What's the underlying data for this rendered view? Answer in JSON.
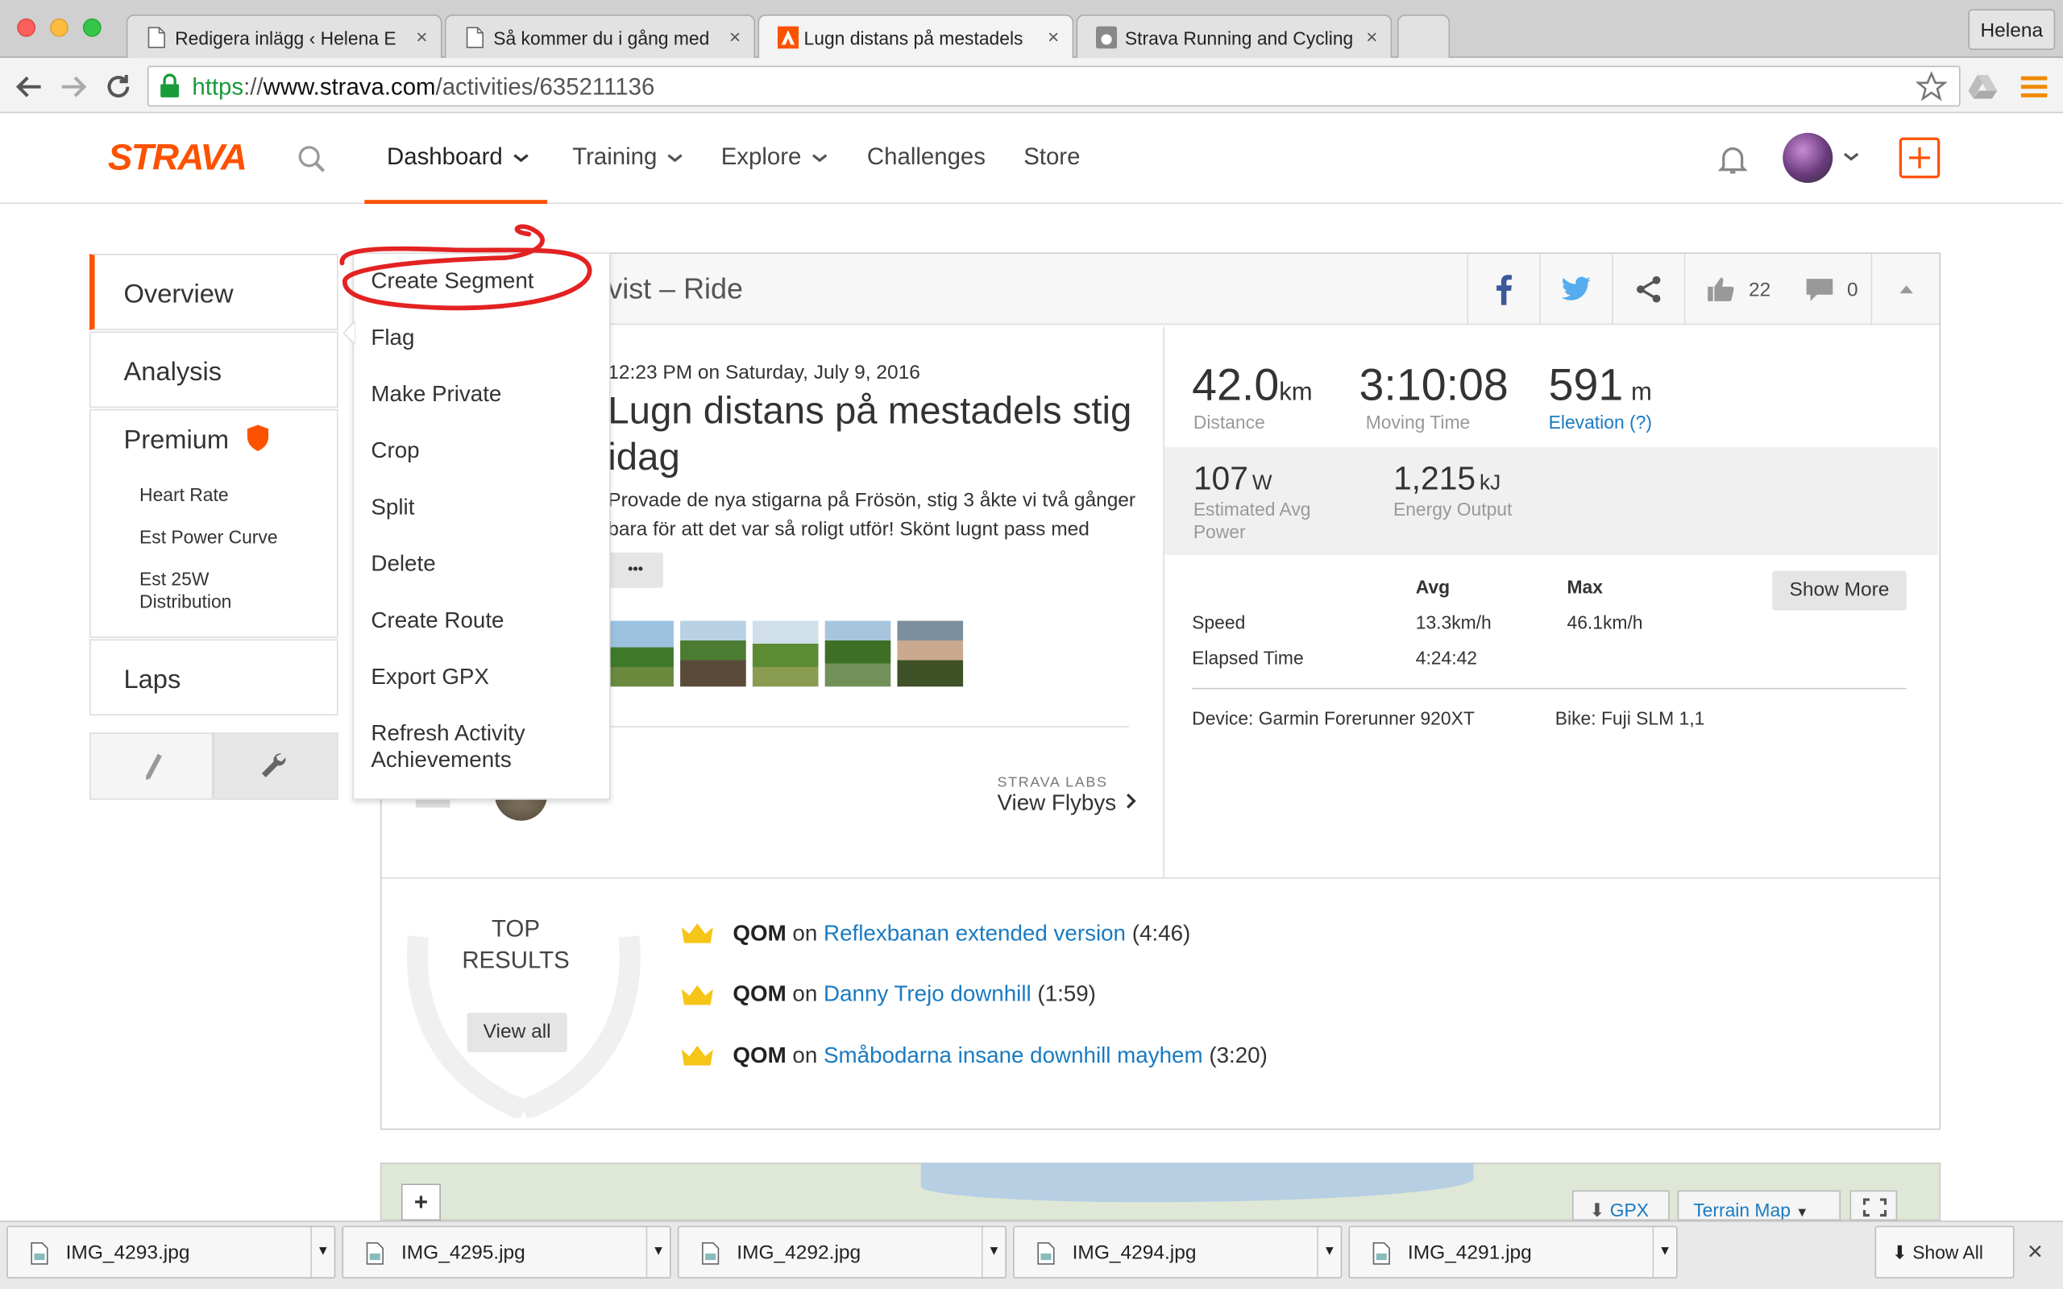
{
  "browser": {
    "tabs": [
      {
        "title": "Redigera inlägg ‹ Helena E"
      },
      {
        "title": "Så kommer du i gång med"
      },
      {
        "title": "Lugn distans på mestadels"
      },
      {
        "title": "Strava Running and Cycling"
      }
    ],
    "profile": "Helena",
    "url_scheme": "https",
    "url_sep": "://",
    "url_domain": "www.strava.com",
    "url_path": "/activities/635211136",
    "tab_close_glyph": "×"
  },
  "header": {
    "logo": "STRAVA",
    "nav": [
      {
        "label": "Dashboard",
        "has_caret": true
      },
      {
        "label": "Training",
        "has_caret": true
      },
      {
        "label": "Explore",
        "has_caret": true
      },
      {
        "label": "Challenges"
      },
      {
        "label": "Store"
      }
    ],
    "accent": "#fc5200"
  },
  "sidebar": {
    "overview": "Overview",
    "analysis": "Analysis",
    "premium": "Premium",
    "premium_items": [
      "Heart Rate",
      "Est Power Curve",
      "Est 25W Distribution"
    ],
    "laps": "Laps"
  },
  "actions_menu": {
    "items": [
      "Create Segment",
      "Flag",
      "Make Private",
      "Crop",
      "Split",
      "Delete",
      "Create Route",
      "Export GPX",
      "Refresh Activity Achievements"
    ]
  },
  "activity": {
    "header_title": "vist – Ride",
    "kudos": "22",
    "comments": "0",
    "datetime": "12:23 PM on Saturday, July 9, 2016",
    "title_line1": "Lugn distans på mestadels stig",
    "title_line2": "idag",
    "desc_line1": "Provade de nya stigarna på Frösön, stig 3 åkte vi två gånger",
    "desc_line2": "bara för att det var så roligt utför! Skönt lugnt pass med",
    "more": "•••",
    "labs": "STRAVA LABS",
    "flybys": "View Flybys"
  },
  "stats": {
    "distance": {
      "value": "42.0",
      "unit": "km",
      "label": "Distance"
    },
    "moving_time": {
      "value": "3:10:08",
      "label": "Moving Time"
    },
    "elevation": {
      "value": "591",
      "unit": "m",
      "label": "Elevation (?)"
    },
    "power": {
      "value": "107",
      "unit": "W",
      "label_l1": "Estimated Avg",
      "label_l2": "Power"
    },
    "energy": {
      "value": "1,215",
      "unit": "kJ",
      "label": "Energy Output"
    },
    "table": {
      "col_avg": "Avg",
      "col_max": "Max",
      "rows": [
        {
          "label": "Speed",
          "avg": "13.3km/h",
          "max": "46.1km/h"
        },
        {
          "label": "Elapsed Time",
          "avg": "4:24:42",
          "max": ""
        }
      ]
    },
    "show_more": "Show More",
    "device": "Device: Garmin Forerunner 920XT",
    "bike": "Bike: Fuji SLM 1,1"
  },
  "top_results": {
    "title_l1": "TOP",
    "title_l2": "RESULTS",
    "view_all": "View all",
    "items": [
      {
        "badge": "QOM",
        "on": "on",
        "segment": "Reflexbanan extended version",
        "time": "(4:46)"
      },
      {
        "badge": "QOM",
        "on": "on",
        "segment": "Danny Trejo downhill",
        "time": "(1:59)"
      },
      {
        "badge": "QOM",
        "on": "on",
        "segment": "Småbodarna insane downhill mayhem",
        "time": "(3:20)"
      }
    ]
  },
  "map": {
    "zoom_in": "+",
    "gpx": "GPX",
    "terrain": "Terrain Map"
  },
  "downloads": {
    "files": [
      "IMG_4293.jpg",
      "IMG_4295.jpg",
      "IMG_4292.jpg",
      "IMG_4294.jpg",
      "IMG_4291.jpg"
    ],
    "show_all": "Show All",
    "close": "×"
  }
}
